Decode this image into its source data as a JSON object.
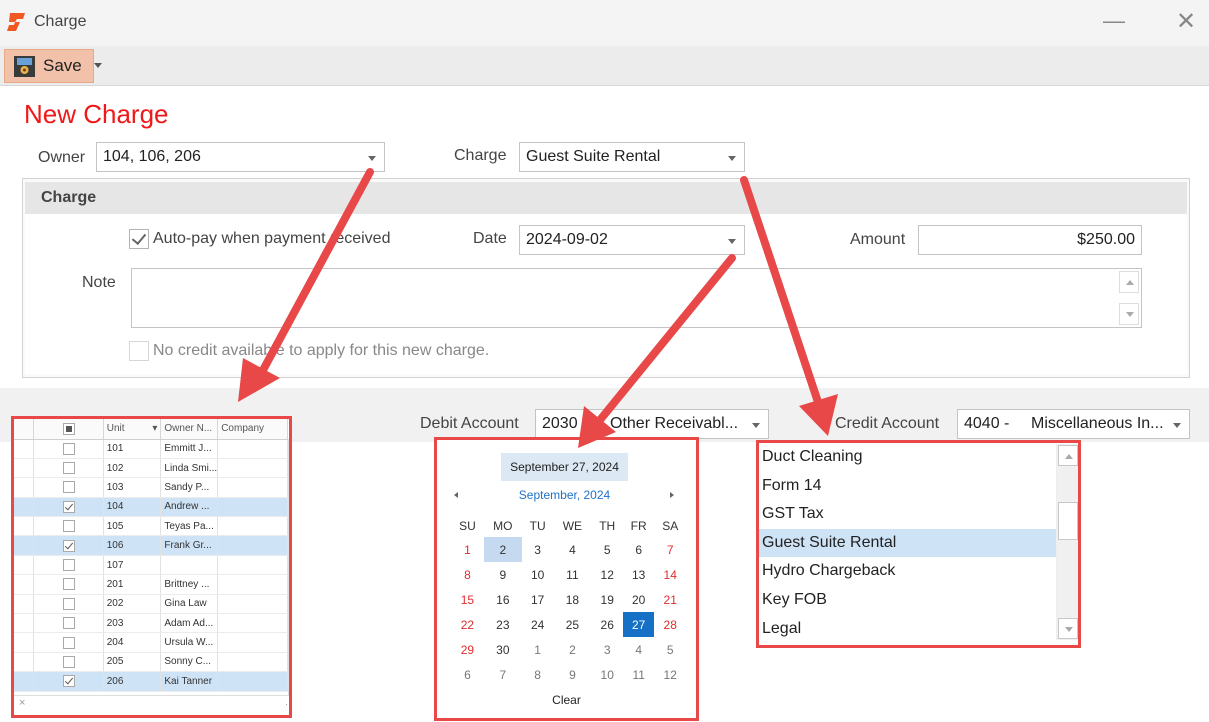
{
  "window": {
    "title": "Charge",
    "minimize_glyph": "—",
    "close_glyph": "✕"
  },
  "toolbar": {
    "save_label": "Save"
  },
  "form": {
    "heading": "New Charge",
    "owner_label": "Owner",
    "owner_value": "104, 106, 206",
    "charge_label": "Charge",
    "charge_value": "Guest Suite Rental",
    "group_title": "Charge",
    "autopay_label": "Auto-pay when payment received",
    "autopay_checked": true,
    "date_label": "Date",
    "date_value": "2024-09-02",
    "amount_label": "Amount",
    "amount_value": "$250.00",
    "note_label": "Note",
    "note_value": "",
    "credit_note_label": "No credit available to apply for this new charge.",
    "debit_label": "Debit Account",
    "debit_code": "2030",
    "debit_name": "Other Receivabl...",
    "credit_label": "Credit Account",
    "credit_code": "4040 -",
    "credit_name": "Miscellaneous In..."
  },
  "owner_grid": {
    "columns": [
      "Unit",
      "Owner N...",
      "Company"
    ],
    "rows": [
      {
        "unit": "101",
        "owner": "Emmitt J...",
        "company": "",
        "checked": false
      },
      {
        "unit": "102",
        "owner": "Linda Smi...",
        "company": "",
        "checked": false
      },
      {
        "unit": "103",
        "owner": "Sandy P...",
        "company": "",
        "checked": false
      },
      {
        "unit": "104",
        "owner": "Andrew ...",
        "company": "",
        "checked": true
      },
      {
        "unit": "105",
        "owner": "Teyas Pa...",
        "company": "",
        "checked": false
      },
      {
        "unit": "106",
        "owner": "Frank Gr...",
        "company": "",
        "checked": true
      },
      {
        "unit": "107",
        "owner": "",
        "company": "",
        "checked": false
      },
      {
        "unit": "201",
        "owner": "Brittney ...",
        "company": "",
        "checked": false
      },
      {
        "unit": "202",
        "owner": "Gina Law",
        "company": "",
        "checked": false
      },
      {
        "unit": "203",
        "owner": "Adam Ad...",
        "company": "",
        "checked": false
      },
      {
        "unit": "204",
        "owner": "Ursula W...",
        "company": "",
        "checked": false
      },
      {
        "unit": "205",
        "owner": "Sonny C...",
        "company": "",
        "checked": false
      },
      {
        "unit": "206",
        "owner": "Kai Tanner",
        "company": "",
        "checked": true
      }
    ]
  },
  "calendar": {
    "today_label": "September 27, 2024",
    "month_label": "September, 2024",
    "weekdays": [
      "SU",
      "MO",
      "TU",
      "WE",
      "TH",
      "FR",
      "SA"
    ],
    "weeks": [
      [
        "1",
        "2",
        "3",
        "4",
        "5",
        "6",
        "7"
      ],
      [
        "8",
        "9",
        "10",
        "11",
        "12",
        "13",
        "14"
      ],
      [
        "15",
        "16",
        "17",
        "18",
        "19",
        "20",
        "21"
      ],
      [
        "22",
        "23",
        "24",
        "25",
        "26",
        "27",
        "28"
      ],
      [
        "29",
        "30",
        "1",
        "2",
        "3",
        "4",
        "5"
      ],
      [
        "6",
        "7",
        "8",
        "9",
        "10",
        "11",
        "12"
      ]
    ],
    "selected_date": "2024-09-02",
    "today_date": "2024-09-27",
    "clear_label": "Clear"
  },
  "charge_list": {
    "items": [
      "Duct Cleaning",
      "Form 14",
      "GST Tax",
      "Guest Suite Rental",
      "Hydro Chargeback",
      "Key FOB",
      "Legal"
    ],
    "selected": "Guest Suite Rental"
  },
  "colors": {
    "heading": "#f01818",
    "annotation": "#e84848",
    "selection": "#cfe3f6",
    "calendar_selected": "#1570c6",
    "save_button": "#f2c1a9"
  },
  "icons": {
    "app": "app-logo-icon",
    "save": "save-icon",
    "close": "close-icon"
  }
}
